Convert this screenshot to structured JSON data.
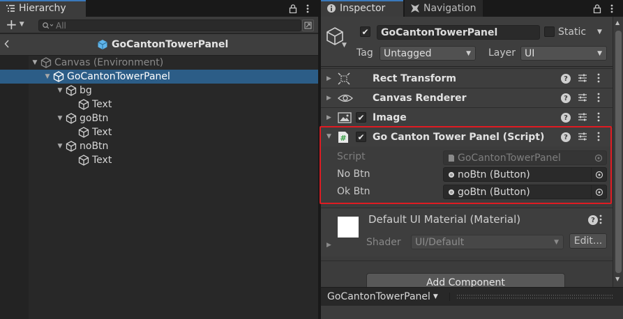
{
  "hierarchy": {
    "tab_label": "Hierarchy",
    "add_label": "+",
    "search": {
      "placeholder": "All",
      "value": ""
    },
    "scene_title": "GoCantonTowerPanel",
    "rows": [
      {
        "label": "Canvas (Environment)",
        "depth": 0,
        "expanded": true,
        "selected": false,
        "env": true
      },
      {
        "label": "GoCantonTowerPanel",
        "depth": 1,
        "expanded": true,
        "selected": true,
        "env": false
      },
      {
        "label": "bg",
        "depth": 2,
        "expanded": true,
        "selected": false,
        "env": false
      },
      {
        "label": "Text",
        "depth": 3,
        "expanded": false,
        "selected": false,
        "env": false
      },
      {
        "label": "goBtn",
        "depth": 2,
        "expanded": true,
        "selected": false,
        "env": false
      },
      {
        "label": "Text",
        "depth": 3,
        "expanded": false,
        "selected": false,
        "env": false
      },
      {
        "label": "noBtn",
        "depth": 2,
        "expanded": true,
        "selected": false,
        "env": false
      },
      {
        "label": "Text",
        "depth": 3,
        "expanded": false,
        "selected": false,
        "env": false
      }
    ]
  },
  "inspector": {
    "tab_label": "Inspector",
    "nav_tab_label": "Navigation",
    "object_name": "GoCantonTowerPanel",
    "static_label": "Static",
    "tag_label": "Tag",
    "tag_value": "Untagged",
    "layer_label": "Layer",
    "layer_value": "UI",
    "components": [
      {
        "title": "Rect Transform",
        "icon": "rect-transform-icon",
        "has_checkbox": false
      },
      {
        "title": "Canvas Renderer",
        "icon": "eye-icon",
        "has_checkbox": false
      },
      {
        "title": "Image",
        "icon": "image-icon",
        "has_checkbox": true
      },
      {
        "title": "Go Canton Tower Panel (Script)",
        "icon": "script-icon",
        "has_checkbox": true
      }
    ],
    "script_props": {
      "script_label": "Script",
      "script_value": "GoCantonTowerPanel",
      "no_btn_label": "No Btn",
      "no_btn_value": "noBtn (Button)",
      "ok_btn_label": "Ok Btn",
      "ok_btn_value": "goBtn (Button)"
    },
    "material": {
      "title": "Default UI Material (Material)",
      "shader_label": "Shader",
      "shader_value": "UI/Default",
      "edit_label": "Edit..."
    },
    "add_component_label": "Add Component",
    "footer_title": "GoCantonTowerPanel"
  },
  "colors": {
    "selection": "#2c5d87",
    "highlight_border": "#e01b22",
    "cube_accent": "#5fb4ea"
  }
}
